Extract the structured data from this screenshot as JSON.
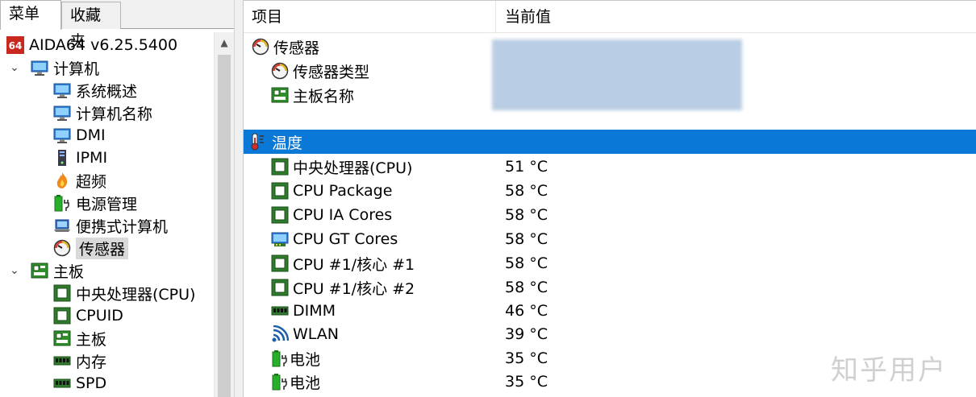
{
  "tabs": {
    "menu": "菜单",
    "favorites": "收藏夹"
  },
  "tree": {
    "root": {
      "icon": "aida64-logo",
      "label": "AIDA64 v6.25.5400"
    },
    "items": [
      {
        "label": "计算机",
        "icon": "computer-icon",
        "level": 1,
        "expanded": true
      },
      {
        "label": "系统概述",
        "icon": "computer-icon",
        "level": 2
      },
      {
        "label": "计算机名称",
        "icon": "computer-icon",
        "level": 2
      },
      {
        "label": "DMI",
        "icon": "computer-icon",
        "level": 2
      },
      {
        "label": "IPMI",
        "icon": "server-icon",
        "level": 2
      },
      {
        "label": "超频",
        "icon": "flame-icon",
        "level": 2
      },
      {
        "label": "电源管理",
        "icon": "battery-icon",
        "level": 2
      },
      {
        "label": "便携式计算机",
        "icon": "laptop-icon",
        "level": 2
      },
      {
        "label": "传感器",
        "icon": "gauge-icon",
        "level": 2,
        "selected": true
      },
      {
        "label": "主板",
        "icon": "motherboard-icon",
        "level": 1,
        "expanded": true
      },
      {
        "label": "中央处理器(CPU)",
        "icon": "cpu-icon",
        "level": 2
      },
      {
        "label": "CPUID",
        "icon": "cpu-icon",
        "level": 2
      },
      {
        "label": "主板",
        "icon": "motherboard-icon",
        "level": 2
      },
      {
        "label": "内存",
        "icon": "memory-icon",
        "level": 2
      },
      {
        "label": "SPD",
        "icon": "memory-icon",
        "level": 2
      }
    ]
  },
  "columns": {
    "item": "项目",
    "value": "当前值"
  },
  "sensor_section": {
    "title": "传感器",
    "rows": [
      {
        "name": "传感器类型",
        "icon": "gauge-icon"
      },
      {
        "name": "主板名称",
        "icon": "motherboard-icon"
      }
    ]
  },
  "temperature_section": {
    "title": "温度",
    "rows": [
      {
        "name": "中央处理器(CPU)",
        "icon": "cpu-icon",
        "value": "51 °C"
      },
      {
        "name": "CPU Package",
        "icon": "cpu-icon",
        "value": "58 °C"
      },
      {
        "name": "CPU IA Cores",
        "icon": "cpu-icon",
        "value": "58 °C"
      },
      {
        "name": "CPU GT Cores",
        "icon": "gpu-icon",
        "value": "58 °C"
      },
      {
        "name": "CPU #1/核心 #1",
        "icon": "cpu-icon",
        "value": "58 °C"
      },
      {
        "name": "CPU #1/核心 #2",
        "icon": "cpu-icon",
        "value": "58 °C"
      },
      {
        "name": "DIMM",
        "icon": "memory-icon",
        "value": "46 °C"
      },
      {
        "name": "WLAN",
        "icon": "wifi-icon",
        "value": "39 °C"
      },
      {
        "name": "电池",
        "icon": "battery-icon",
        "value": "35 °C"
      },
      {
        "name": "电池",
        "icon": "battery-icon",
        "value": "35 °C"
      }
    ]
  },
  "watermark": "知乎用户",
  "colors": {
    "selection": "#0a78d7",
    "redacted": "#b9cde4"
  }
}
